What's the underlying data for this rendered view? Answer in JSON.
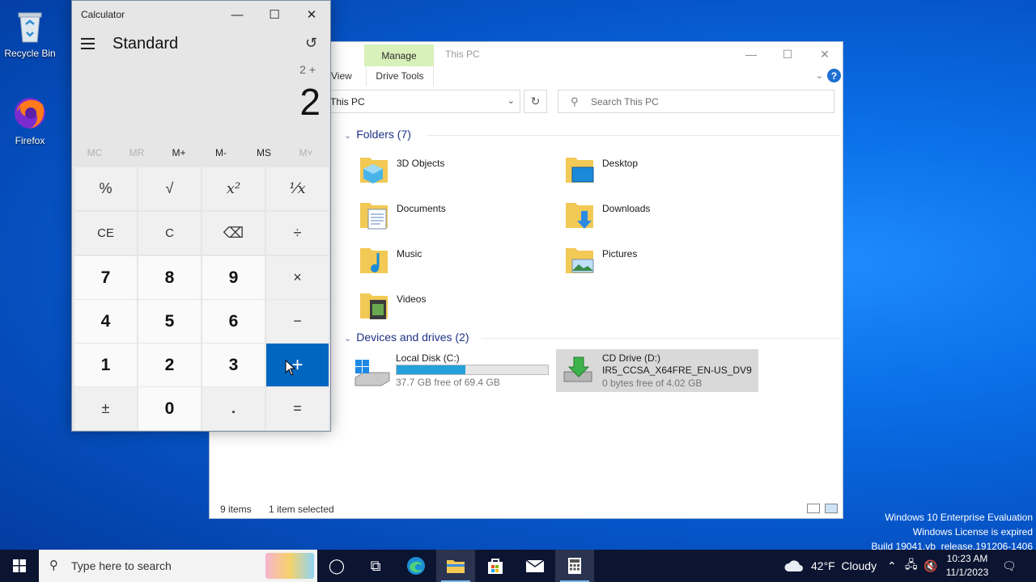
{
  "desktop": {
    "icons": [
      {
        "label": "Recycle Bin"
      },
      {
        "label": "Firefox"
      }
    ],
    "watermark": {
      "line1": "Windows 10 Enterprise Evaluation",
      "line2": "Windows License is expired",
      "line3": "Build 19041.vb_release.191206-1406"
    }
  },
  "explorer": {
    "ribbon_contextual": "Manage",
    "title": "This PC",
    "tabs": {
      "view": "View",
      "drive_tools": "Drive Tools"
    },
    "address": "This PC",
    "search_placeholder": "Search This PC",
    "folders_header": "Folders (7)",
    "folders": [
      {
        "label": "3D Objects"
      },
      {
        "label": "Desktop"
      },
      {
        "label": "Documents"
      },
      {
        "label": "Downloads"
      },
      {
        "label": "Music"
      },
      {
        "label": "Pictures"
      },
      {
        "label": "Videos"
      }
    ],
    "devices_header": "Devices and drives (2)",
    "drives": [
      {
        "label": "Local Disk (C:)",
        "free": "37.7 GB free of 69.4 GB",
        "used_fraction": 0.457
      },
      {
        "label": "CD Drive (D:)",
        "sublabel": "IR5_CCSA_X64FRE_EN-US_DV9",
        "free": "0 bytes free of 4.02 GB"
      }
    ],
    "status_items": "9 items",
    "status_selected": "1 item selected"
  },
  "calculator": {
    "title": "Calculator",
    "mode": "Standard",
    "expression": "2 +",
    "display": "2",
    "memory": [
      "MC",
      "MR",
      "M+",
      "M-",
      "MS",
      "M˅"
    ],
    "keys": [
      [
        "%",
        "√",
        "x²",
        "¹⁄x"
      ],
      [
        "CE",
        "C",
        "⌫",
        "÷"
      ],
      [
        "7",
        "8",
        "9",
        "×"
      ],
      [
        "4",
        "5",
        "6",
        "−"
      ],
      [
        "1",
        "2",
        "3",
        "+"
      ],
      [
        "±",
        "0",
        ".",
        "="
      ]
    ]
  },
  "taskbar": {
    "search_placeholder": "Type here to search",
    "weather": "42°F  Cloudy",
    "time": "10:23 AM",
    "date": "11/1/2023"
  },
  "colors": {
    "accent": "#0067c0",
    "manage_tab": "#d8f0b9",
    "progress": "#26a0da"
  }
}
